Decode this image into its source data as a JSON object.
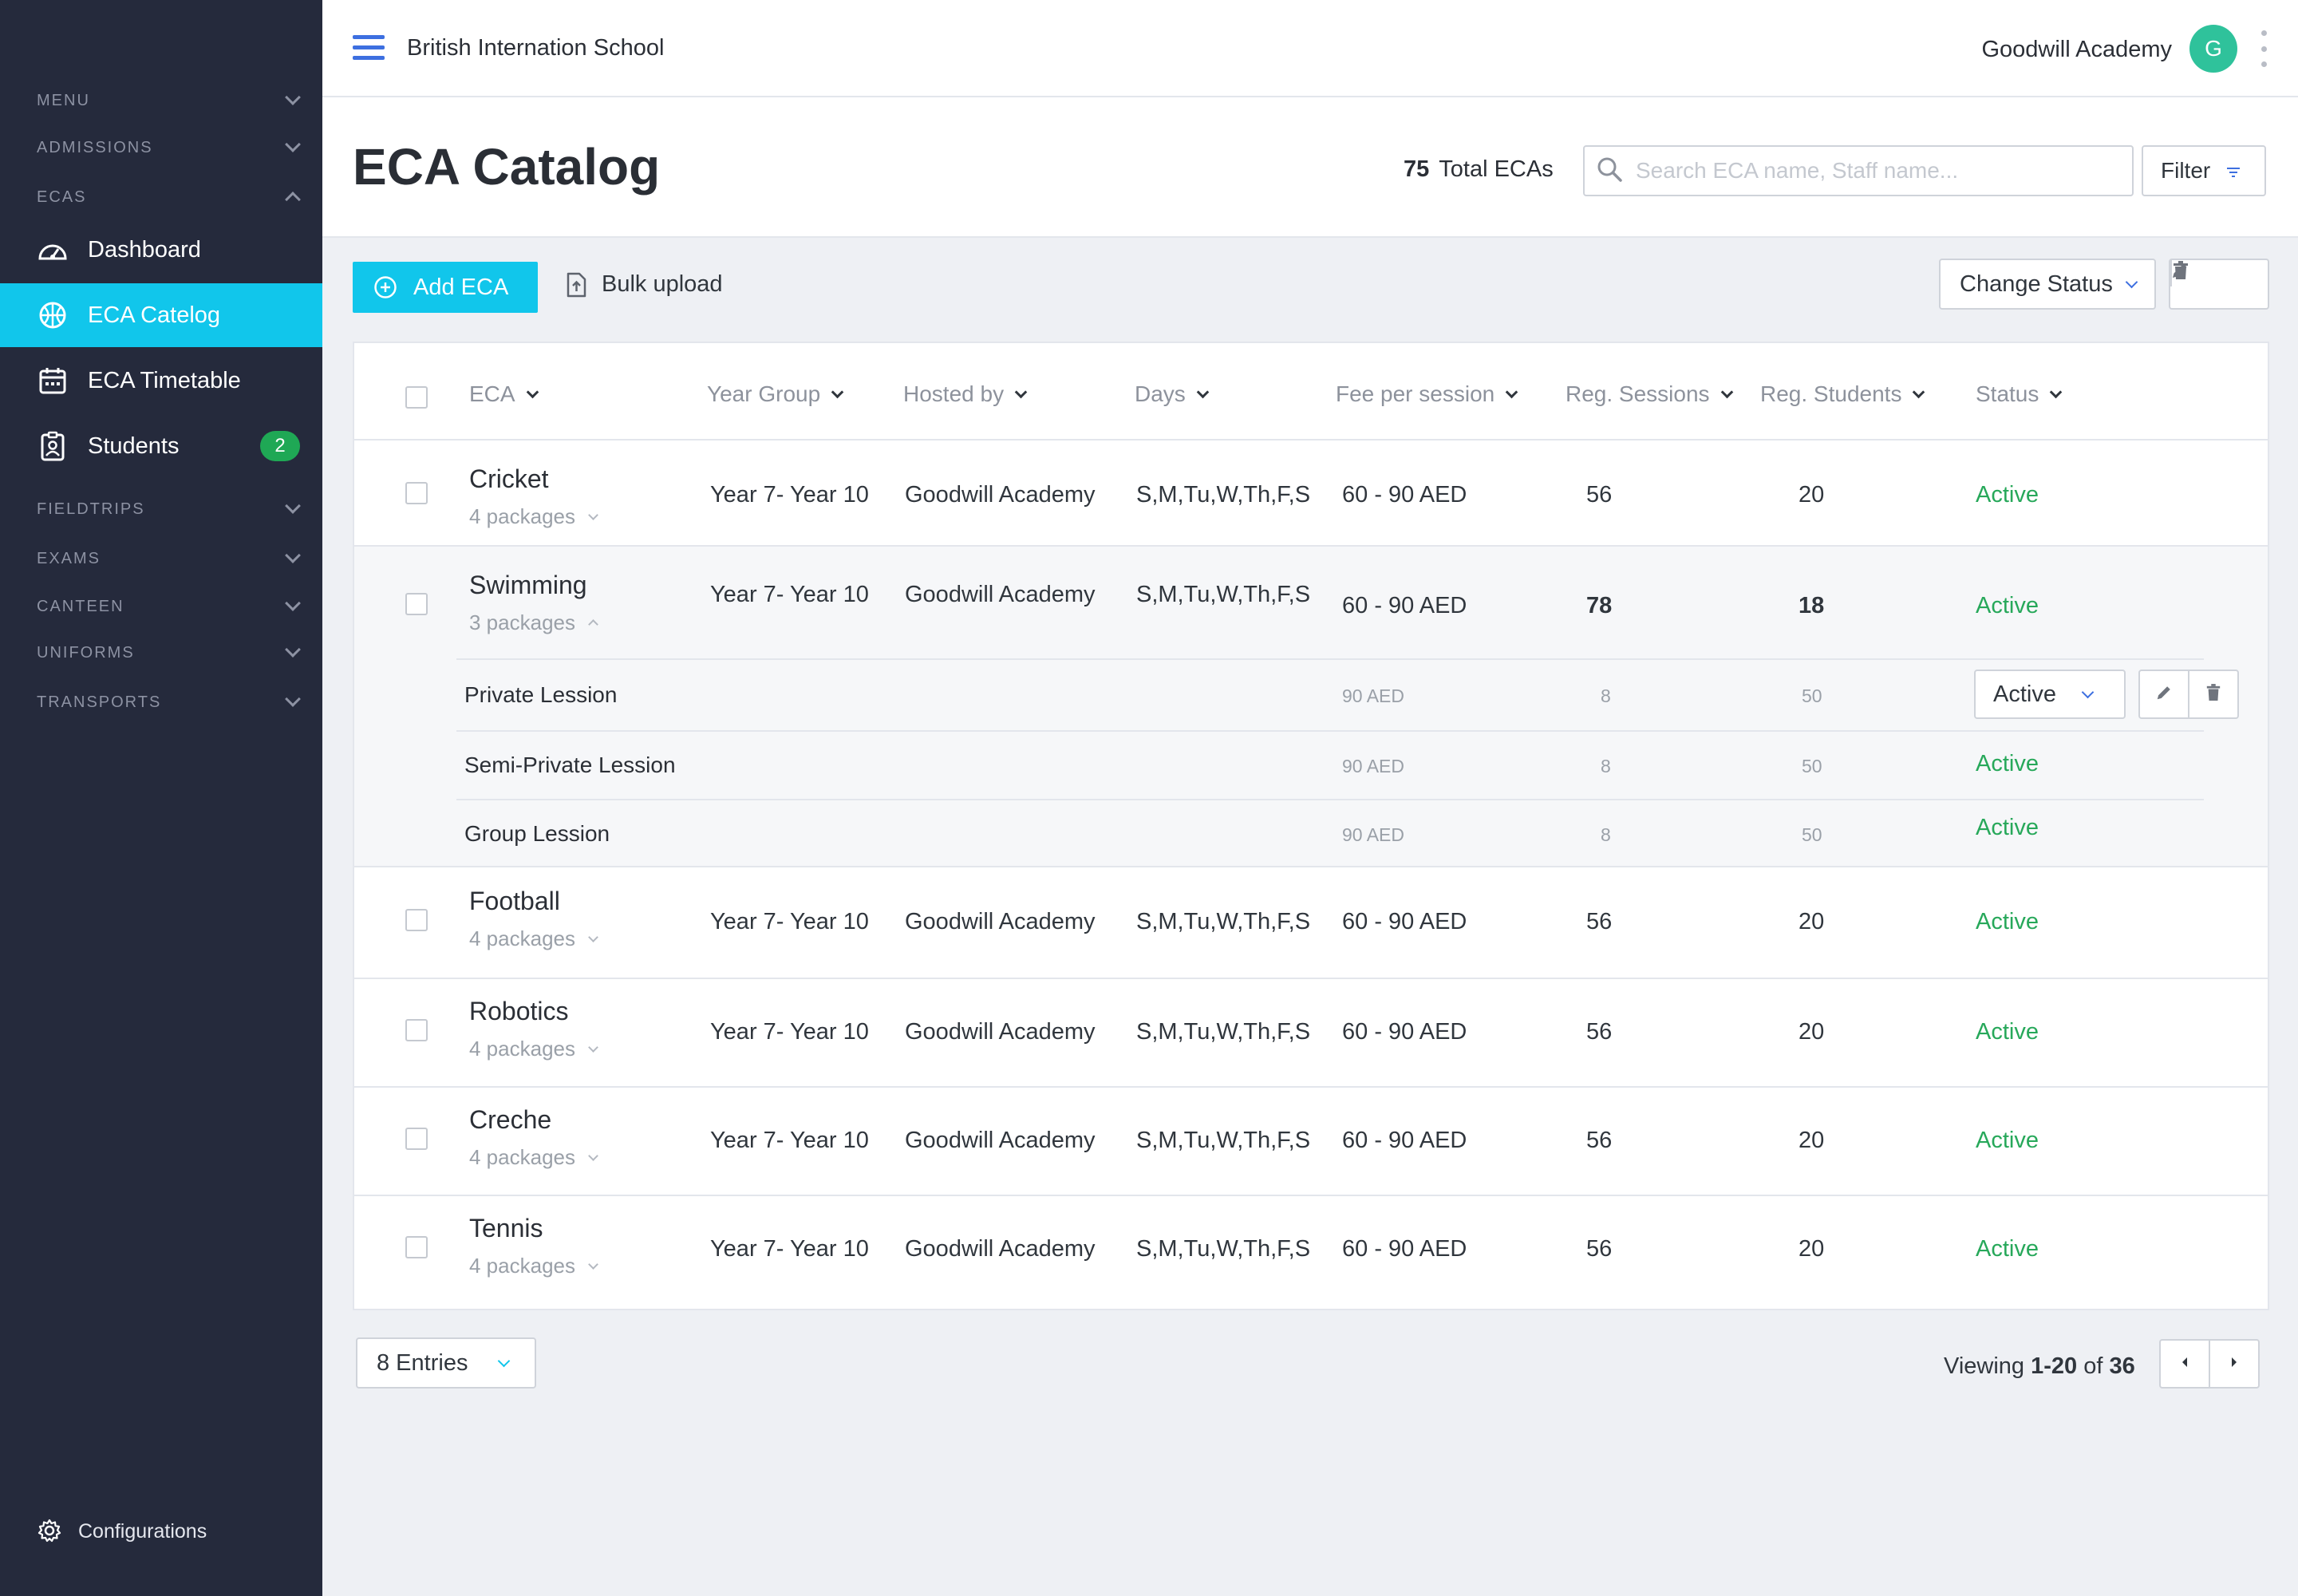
{
  "sidebar": {
    "sections": [
      {
        "label": "MENU",
        "expanded": false
      },
      {
        "label": "ADMISSIONS",
        "expanded": false
      },
      {
        "label": "ECAS",
        "expanded": true
      },
      {
        "label": "FIELDTRIPS",
        "expanded": false
      },
      {
        "label": "EXAMS",
        "expanded": false
      },
      {
        "label": "CANTEEN",
        "expanded": false
      },
      {
        "label": "UNIFORMS",
        "expanded": false
      },
      {
        "label": "TRANSPORTS",
        "expanded": false
      }
    ],
    "ecas_items": [
      {
        "label": "Dashboard",
        "icon": "dashboard-icon",
        "active": false
      },
      {
        "label": "ECA Catelog",
        "icon": "basketball-icon",
        "active": true
      },
      {
        "label": "ECA Timetable",
        "icon": "calendar-icon",
        "active": false
      },
      {
        "label": "Students",
        "icon": "student-badge-icon",
        "active": false,
        "badge": "2"
      }
    ],
    "configurations": "Configurations"
  },
  "topbar": {
    "school": "British Internation School",
    "account": "Goodwill Academy",
    "avatar_initial": "G"
  },
  "header": {
    "title": "ECA Catalog",
    "total_count": "75",
    "total_label": "Total ECAs",
    "search_placeholder": "Search ECA name, Staff name...",
    "filter_label": "Filter"
  },
  "toolbar": {
    "add_label": "Add ECA",
    "bulk_label": "Bulk upload",
    "change_status_label": "Change Status"
  },
  "table": {
    "columns": [
      "ECA",
      "Year Group",
      "Hosted by",
      "Days",
      "Fee per session",
      "Reg. Sessions",
      "Reg. Students",
      "Status"
    ],
    "rows": [
      {
        "name": "Cricket",
        "packages": "4 packages",
        "year_group": "Year 7- Year 10",
        "hosted_by": "Goodwill Academy",
        "days": "S,M,Tu,W,Th,F,S",
        "fee": "60 - 90 AED",
        "sessions": "56",
        "students": "20",
        "status": "Active",
        "expanded": false
      },
      {
        "name": "Swimming",
        "packages": "3 packages",
        "year_group": "Year 7- Year 10",
        "hosted_by": "Goodwill Academy",
        "days": "S,M,Tu,W,Th,F,S",
        "fee": "60 - 90 AED",
        "sessions": "78",
        "students": "18",
        "status": "Active",
        "expanded": true,
        "sub": [
          {
            "name": "Private Lession",
            "fee": "90 AED",
            "sessions": "8",
            "students": "50",
            "status": "Active"
          },
          {
            "name": "Semi-Private Lession",
            "fee": "90 AED",
            "sessions": "8",
            "students": "50",
            "status": "Active"
          },
          {
            "name": "Group Lession",
            "fee": "90 AED",
            "sessions": "8",
            "students": "50",
            "status": "Active"
          }
        ]
      },
      {
        "name": "Football",
        "packages": "4 packages",
        "year_group": "Year 7- Year 10",
        "hosted_by": "Goodwill Academy",
        "days": "S,M,Tu,W,Th,F,S",
        "fee": "60 - 90 AED",
        "sessions": "56",
        "students": "20",
        "status": "Active",
        "expanded": false
      },
      {
        "name": "Robotics",
        "packages": "4 packages",
        "year_group": "Year 7- Year 10",
        "hosted_by": "Goodwill Academy",
        "days": "S,M,Tu,W,Th,F,S",
        "fee": "60 - 90 AED",
        "sessions": "56",
        "students": "20",
        "status": "Active",
        "expanded": false
      },
      {
        "name": "Creche",
        "packages": "4 packages",
        "year_group": "Year 7- Year 10",
        "hosted_by": "Goodwill Academy",
        "days": "S,M,Tu,W,Th,F,S",
        "fee": "60 - 90 AED",
        "sessions": "56",
        "students": "20",
        "status": "Active",
        "expanded": false
      },
      {
        "name": "Tennis",
        "packages": "4 packages",
        "year_group": "Year 7- Year 10",
        "hosted_by": "Goodwill Academy",
        "days": "S,M,Tu,W,Th,F,S",
        "fee": "60 - 90 AED",
        "sessions": "56",
        "students": "20",
        "status": "Active",
        "expanded": false
      }
    ]
  },
  "footer": {
    "entries_label": "8 Entries",
    "viewing_prefix": "Viewing",
    "viewing_range": "1-20",
    "viewing_of": "of",
    "viewing_total": "36"
  },
  "colors": {
    "sidebar_bg": "#252a3c",
    "accent": "#11c6eb",
    "status_active": "#27a85a",
    "badge": "#1fa855",
    "avatar": "#2fc29b"
  }
}
